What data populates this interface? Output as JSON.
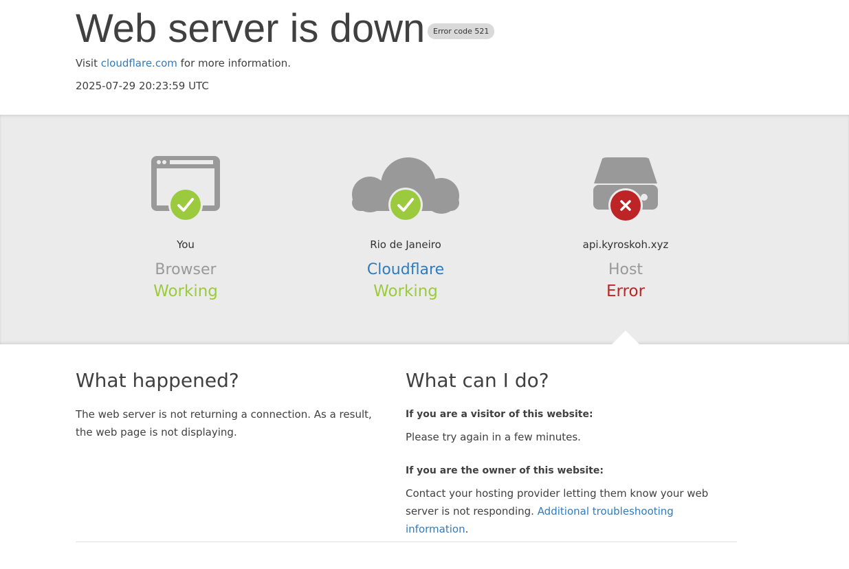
{
  "header": {
    "title": "Web server is down",
    "badge": "Error code 521",
    "visit_prefix": "Visit ",
    "visit_link": "cloudflare.com",
    "visit_suffix": " for more information.",
    "timestamp": "2025-07-29 20:23:59 UTC"
  },
  "status": [
    {
      "location": "You",
      "name": "Browser",
      "state": "Working",
      "result": "ok",
      "icon": "browser-icon"
    },
    {
      "location": "Rio de Janeiro",
      "name": "Cloudflare",
      "state": "Working",
      "result": "ok",
      "icon": "cloud-icon"
    },
    {
      "location": "api.kyroskoh.xyz",
      "name": "Host",
      "state": "Error",
      "result": "error",
      "icon": "server-icon"
    }
  ],
  "what_happened": {
    "heading": "What happened?",
    "body": "The web server is not returning a connection. As a result, the web page is not displaying."
  },
  "what_can_i_do": {
    "heading": "What can I do?",
    "visitor_q": "If you are a visitor of this website:",
    "visitor_a": "Please try again in a few minutes.",
    "owner_q": "If you are the owner of this website:",
    "owner_a": "Contact your hosting provider letting them know your web server is not responding. ",
    "owner_link": "Additional troubleshooting information",
    "owner_suffix": "."
  },
  "colors": {
    "ok": "#9bca3e",
    "error": "#bd2426",
    "link": "#2f7bbf",
    "icon_gray": "#999999"
  }
}
